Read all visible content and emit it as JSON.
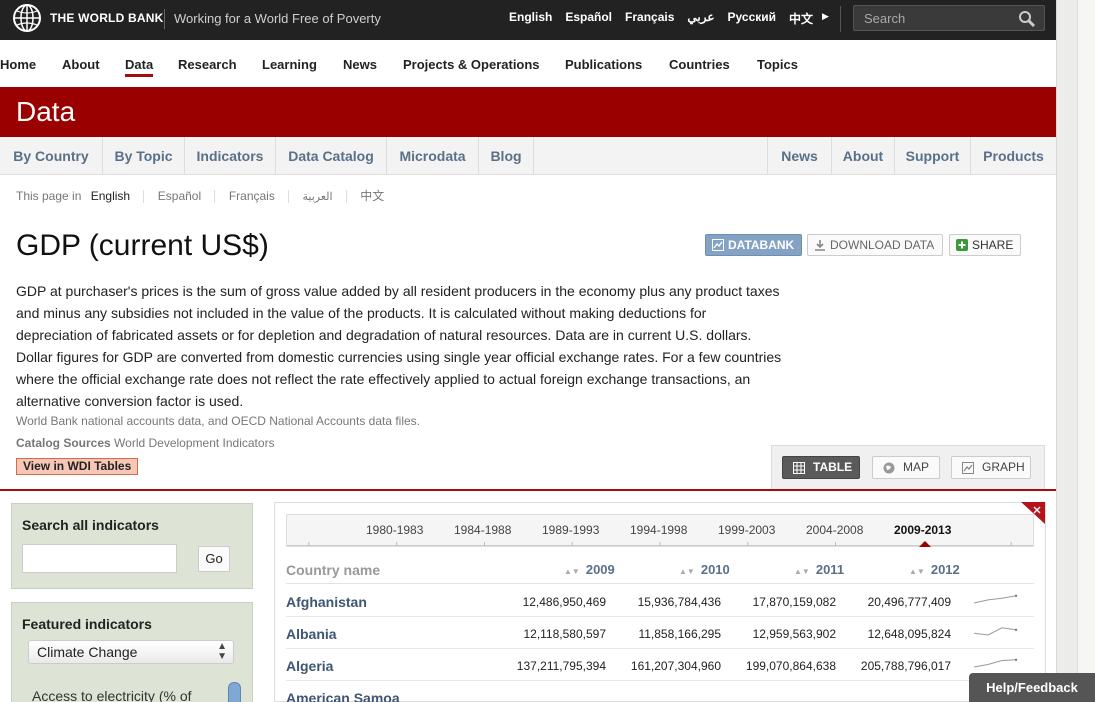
{
  "topbar": {
    "brand": "THE WORLD BANK",
    "tagline": "Working for a World Free of Poverty",
    "languages": [
      "English",
      "Español",
      "Français",
      "عربي",
      "Русский",
      "中文"
    ],
    "search_placeholder": "Search"
  },
  "mainnav": {
    "items": [
      "Home",
      "About",
      "Data",
      "Research",
      "Learning",
      "News",
      "Projects & Operations",
      "Publications",
      "Countries",
      "Topics"
    ],
    "active": "Data"
  },
  "banner": {
    "title": "Data"
  },
  "subnav": {
    "left": [
      "By Country",
      "By Topic",
      "Indicators",
      "Data Catalog",
      "Microdata",
      "Blog"
    ],
    "right": [
      "News",
      "About",
      "Support",
      "Products"
    ]
  },
  "pagelang": {
    "prefix": "This page in",
    "languages": [
      "English",
      "Español",
      "Français",
      "العربية",
      "中文"
    ]
  },
  "indicator": {
    "title": "GDP (current US$)",
    "description": "GDP at purchaser's prices is the sum of gross value added by all resident producers in the economy plus any product taxes and minus any subsidies not included in the value of the products. It is calculated without making deductions for depreciation of fabricated assets or for depletion and degradation of natural resources. Data are in current U.S. dollars. Dollar figures for GDP are converted from domestic currencies using single year official exchange rates. For a few countries where the official exchange rate does not reflect the rate effectively applied to actual foreign exchange transactions, an alternative conversion factor is used.",
    "source": "World Bank national accounts data, and OECD National Accounts data files.",
    "catalog_label": "Catalog Sources",
    "catalog_value": "World Development Indicators",
    "wdi_button": "View in WDI Tables"
  },
  "actions": {
    "databank": "DATABANK",
    "download": "DOWNLOAD DATA",
    "share": "SHARE"
  },
  "viewtabs": {
    "table": "TABLE",
    "map": "MAP",
    "graph": "GRAPH"
  },
  "sidebar": {
    "search_label": "Search all indicators",
    "go_label": "Go",
    "featured_label": "Featured indicators",
    "featured_selected": "Climate Change",
    "featured_first_item": "Access to electricity (% of"
  },
  "timeline": {
    "periods": [
      "1980-1983",
      "1984-1988",
      "1989-1993",
      "1994-1998",
      "1999-2003",
      "2004-2008",
      "2009-2013"
    ],
    "active": "2009-2013"
  },
  "table": {
    "country_header": "Country name",
    "years": [
      "2009",
      "2010",
      "2011",
      "2012"
    ],
    "rows": [
      {
        "country": "Afghanistan",
        "values": [
          "12,486,950,469",
          "15,936,784,436",
          "17,870,159,082",
          "20,496,777,409"
        ],
        "trend": [
          12.49,
          15.94,
          17.87,
          20.5
        ]
      },
      {
        "country": "Albania",
        "values": [
          "12,118,580,597",
          "11,858,166,295",
          "12,959,563,902",
          "12,648,095,824"
        ],
        "trend": [
          12.12,
          11.86,
          12.96,
          12.65
        ]
      },
      {
        "country": "Algeria",
        "values": [
          "137,211,795,394",
          "161,207,304,960",
          "199,070,864,638",
          "205,788,796,017"
        ],
        "trend": [
          137.2,
          161.2,
          199.1,
          205.8
        ]
      },
      {
        "country": "American Samoa",
        "values": [
          "",
          "",
          "",
          ""
        ],
        "trend": []
      }
    ]
  },
  "help": "Help/Feedback",
  "colors": {
    "brand_red": "#9b0000",
    "link_blue": "#3d5673",
    "sidebar_green": "#dde3d5"
  }
}
